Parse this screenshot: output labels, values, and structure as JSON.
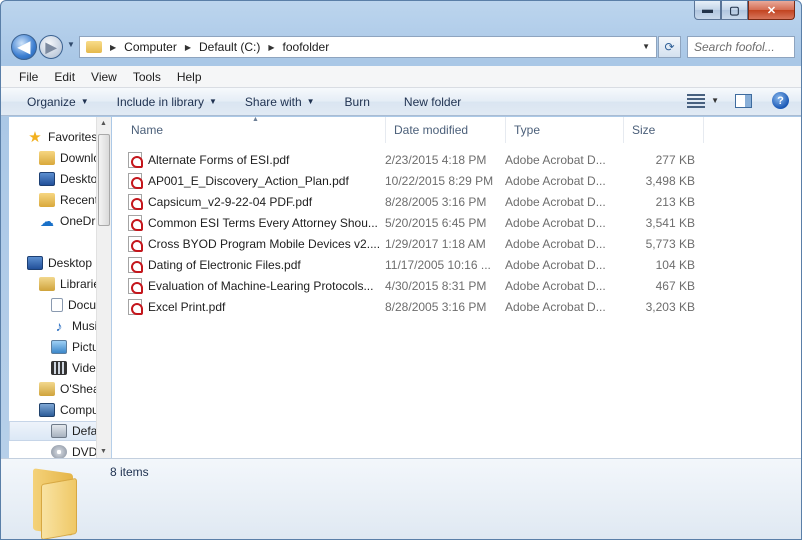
{
  "window": {
    "caption_buttons": {
      "minimize": "▬",
      "maximize": "▢",
      "close": "✕"
    }
  },
  "address_bar": {
    "crumbs": [
      "Computer",
      "Default (C:)",
      "foofolder"
    ],
    "search_placeholder": "Search foofol..."
  },
  "menu": [
    "File",
    "Edit",
    "View",
    "Tools",
    "Help"
  ],
  "command_bar": {
    "organize": "Organize",
    "include_in_library": "Include in library",
    "share_with": "Share with",
    "burn": "Burn",
    "new_folder": "New folder",
    "help": "?"
  },
  "nav_pane": {
    "items": [
      {
        "label": "Favorites",
        "icon": "star-icon"
      },
      {
        "label": "Downloads",
        "icon": "downloads-folder-icon"
      },
      {
        "label": "Desktop",
        "icon": "desktop-icon"
      },
      {
        "label": "Recent Places",
        "icon": "recent-places-icon"
      },
      {
        "label": "OneDrive",
        "icon": "onedrive-icon"
      },
      {
        "label": "Desktop",
        "icon": "desktop-icon"
      },
      {
        "label": "Libraries",
        "icon": "libraries-icon"
      },
      {
        "label": "Documents",
        "icon": "documents-icon"
      },
      {
        "label": "Music",
        "icon": "music-icon"
      },
      {
        "label": "Pictures",
        "icon": "pictures-icon"
      },
      {
        "label": "Videos",
        "icon": "videos-icon"
      },
      {
        "label": "O'Shea",
        "icon": "user-folder-icon"
      },
      {
        "label": "Computer",
        "icon": "computer-icon"
      },
      {
        "label": "Default (C:)",
        "icon": "drive-icon",
        "selected": true
      },
      {
        "label": "DVD",
        "icon": "dvd-drive-icon"
      }
    ]
  },
  "file_list": {
    "columns": [
      "Name",
      "Date modified",
      "Type",
      "Size"
    ],
    "rows": [
      {
        "name": "Alternate Forms of ESI.pdf",
        "date": "2/23/2015 4:18 PM",
        "type": "Adobe Acrobat D...",
        "size": "277 KB"
      },
      {
        "name": "AP001_E_Discovery_Action_Plan.pdf",
        "date": "10/22/2015 8:29 PM",
        "type": "Adobe Acrobat D...",
        "size": "3,498 KB"
      },
      {
        "name": "Capsicum_v2-9-22-04 PDF.pdf",
        "date": "8/28/2005 3:16 PM",
        "type": "Adobe Acrobat D...",
        "size": "213 KB"
      },
      {
        "name": "Common ESI Terms Every Attorney Shou...",
        "date": "5/20/2015 6:45 PM",
        "type": "Adobe Acrobat D...",
        "size": "3,541 KB"
      },
      {
        "name": "Cross BYOD Program Mobile Devices v2....",
        "date": "1/29/2017 1:18 AM",
        "type": "Adobe Acrobat D...",
        "size": "5,773 KB"
      },
      {
        "name": "Dating of Electronic Files.pdf",
        "date": "11/17/2005 10:16 ...",
        "type": "Adobe Acrobat D...",
        "size": "104 KB"
      },
      {
        "name": "Evaluation of Machine-Learing Protocols...",
        "date": "4/30/2015 8:31 PM",
        "type": "Adobe Acrobat D...",
        "size": "467 KB"
      },
      {
        "name": "Excel Print.pdf",
        "date": "8/28/2005 3:16 PM",
        "type": "Adobe Acrobat D...",
        "size": "3,203 KB"
      }
    ]
  },
  "details_pane": {
    "items_count": "8 items"
  }
}
